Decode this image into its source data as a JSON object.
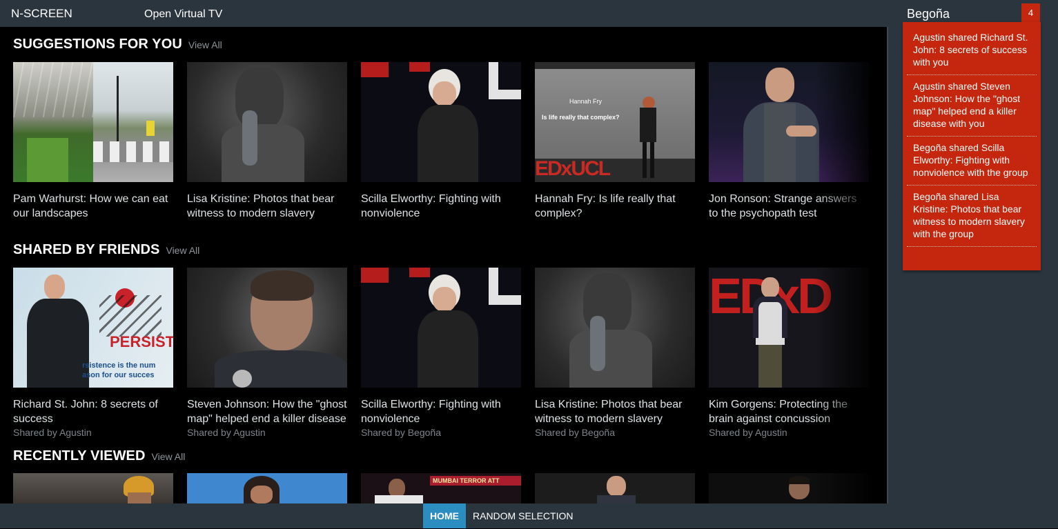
{
  "header": {
    "brand": "N-SCREEN",
    "subtitle": "Open Virtual TV",
    "username": "Begoña",
    "notification_count": "4"
  },
  "notifications": [
    {
      "text": "Agustin shared Richard St. John: 8 secrets of success with you"
    },
    {
      "text": "Agustin shared Steven Johnson: How the \"ghost map\" helped end a killer disease with you"
    },
    {
      "text": "Begoña shared Scilla Elworthy: Fighting with nonviolence with the group"
    },
    {
      "text": "Begoña shared Lisa Kristine: Photos that bear witness to modern slavery with the group"
    }
  ],
  "sections": {
    "suggestions": {
      "title": "SUGGESTIONS FOR YOU",
      "view_all": "View All",
      "items": [
        {
          "title": "Pam Warhurst: How we can eat our landscapes"
        },
        {
          "title": "Lisa Kristine: Photos that bear witness to modern slavery"
        },
        {
          "title": "Scilla Elworthy: Fighting with nonviolence"
        },
        {
          "title": "Hannah Fry: Is life really that complex?"
        },
        {
          "title": "Jon Ronson: Strange answers to the psychopath test"
        }
      ]
    },
    "shared": {
      "title": "SHARED BY FRIENDS",
      "view_all": "View All",
      "items": [
        {
          "title": "Richard St. John: 8 secrets of success",
          "shared_by": "Shared by Agustin"
        },
        {
          "title": "Steven Johnson: How the \"ghost map\" helped end a killer disease",
          "shared_by": "Shared by Agustin"
        },
        {
          "title": "Scilla Elworthy: Fighting with nonviolence",
          "shared_by": "Shared by Begoña"
        },
        {
          "title": "Lisa Kristine: Photos that bear witness to modern slavery",
          "shared_by": "Shared by Begoña"
        },
        {
          "title": "Kim Gorgens: Protecting the brain against concussion",
          "shared_by": "Shared by Agustin"
        }
      ]
    },
    "recent": {
      "title": "RECENTLY VIEWED",
      "view_all": "View All"
    }
  },
  "thumb_text": {
    "hannah_slide_1": "Hannah Fry",
    "hannah_slide_2": "Is life really that complex?",
    "hannah_logo": "EDxUCL",
    "persist": "PERSIST",
    "persist_caption": "rsistence is the num\nason for our succes",
    "kim_logo": "EDxD",
    "mumbai": "MUMBAI TERROR ATT"
  },
  "bottom_nav": {
    "home": "HOME",
    "random": "RANDOM SELECTION"
  }
}
